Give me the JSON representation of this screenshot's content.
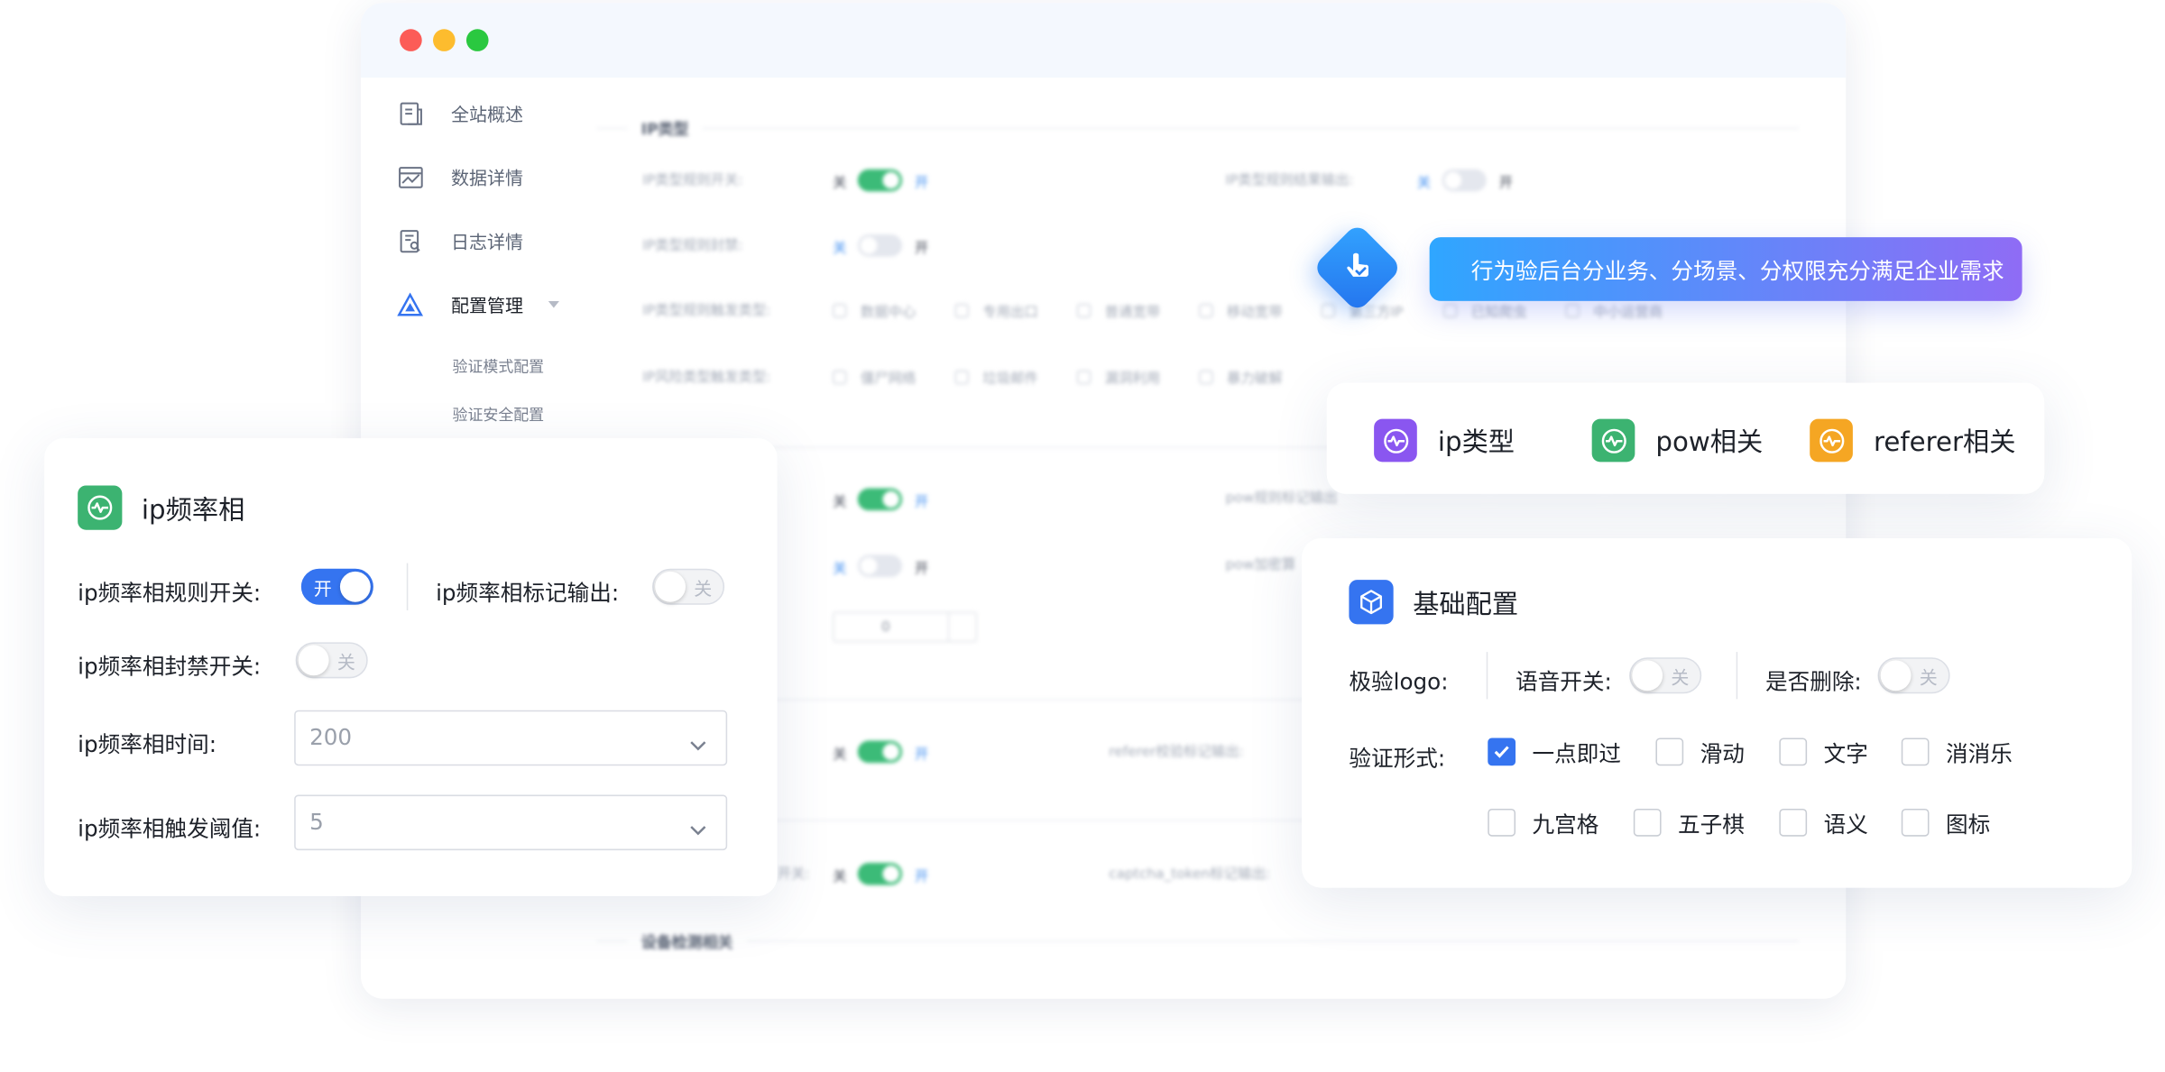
{
  "sidebar": {
    "items": [
      {
        "label": "全站概述",
        "icon": "document-icon"
      },
      {
        "label": "数据详情",
        "icon": "chart-image-icon"
      },
      {
        "label": "日志详情",
        "icon": "log-search-icon"
      },
      {
        "label": "配置管理",
        "icon": "triangle-settings-icon"
      }
    ],
    "subitems": [
      "验证模式配置",
      "验证安全配置"
    ]
  },
  "background_panel": {
    "section_ip": "IP类型",
    "section_device": "设备检测相关",
    "ip_rule_switch": "IP类型规则开关:",
    "ip_rule_output": "IP类型规则结果输出:",
    "ip_rule_ban": "IP类型规则封禁:",
    "ip_trigger": "IP类型规则触发类型:",
    "ip_risk": "IP风险类型触发类型:",
    "ip_trigger_opts": [
      "数据中心",
      "专用出口",
      "普通宽带",
      "移动宽带",
      "第三方IP",
      "已知爬虫",
      "中小运营商"
    ],
    "ip_risk_opts": [
      "僵尸网络",
      "垃圾邮件",
      "漏洞利用",
      "暴力破解"
    ],
    "pow_mark": "pow规则标记输出",
    "pow_encrypt": "pow加密算",
    "stepper_value": "0",
    "referer_mark": "referer校验标记输出:",
    "captcha_left": "开关:",
    "captcha_mark": "captcha_token标记输出:",
    "on": "开",
    "off": "关"
  },
  "ip_freq_card": {
    "title": "ip频率相",
    "rule_switch_label": "ip频率相规则开关:",
    "rule_switch_state": "开",
    "mark_output_label": "ip频率相标记输出:",
    "mark_output_state": "关",
    "ban_switch_label": "ip频率相封禁开关:",
    "ban_switch_state": "关",
    "time_label": "ip频率相时间:",
    "time_value": "200",
    "threshold_label": "ip频率相触发阈值:",
    "threshold_value": "5"
  },
  "banner": {
    "text": "行为验后台分业务、分场景、分权限充分满足企业需求"
  },
  "tags": [
    {
      "label": "ip类型",
      "color": "#8a56f0"
    },
    {
      "label": "pow相关",
      "color": "#3cb371"
    },
    {
      "label": "referer相关",
      "color": "#f5a623"
    }
  ],
  "basic_config": {
    "title": "基础配置",
    "logo_label": "极验logo:",
    "voice_label": "语音开关:",
    "voice_state": "关",
    "delete_label": "是否删除:",
    "delete_state": "关",
    "verify_label": "验证形式:",
    "options": [
      {
        "label": "一点即过",
        "checked": true
      },
      {
        "label": "滑动",
        "checked": false
      },
      {
        "label": "文字",
        "checked": false
      },
      {
        "label": "消消乐",
        "checked": false
      },
      {
        "label": "九宫格",
        "checked": false
      },
      {
        "label": "五子棋",
        "checked": false
      },
      {
        "label": "语义",
        "checked": false
      },
      {
        "label": "图标",
        "checked": false
      }
    ]
  },
  "colors": {
    "primary": "#3574f0",
    "green": "#3cb371",
    "purple": "#8a56f0",
    "orange": "#f5a623",
    "toggle_on_mini": "#3cbb78"
  }
}
